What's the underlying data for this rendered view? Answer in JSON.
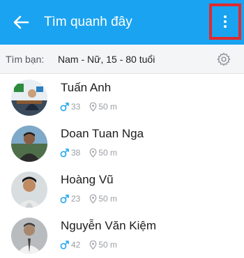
{
  "header": {
    "title": "Tìm quanh đây",
    "background": "#1aa3f0",
    "highlight_border": "#e02a2e"
  },
  "filter": {
    "label": "Tìm bạn:",
    "value": "Nam - Nữ, 15 - 80 tuổi"
  },
  "people": [
    {
      "name": "Tuấn Anh",
      "age": "33",
      "distance": "50 m"
    },
    {
      "name": "Doan Tuan Nga",
      "age": "38",
      "distance": "50 m"
    },
    {
      "name": "Hoàng Vũ",
      "age": "23",
      "distance": "50 m"
    },
    {
      "name": "Nguyễn Văn Kiệm",
      "age": "42",
      "distance": "50 m"
    }
  ]
}
